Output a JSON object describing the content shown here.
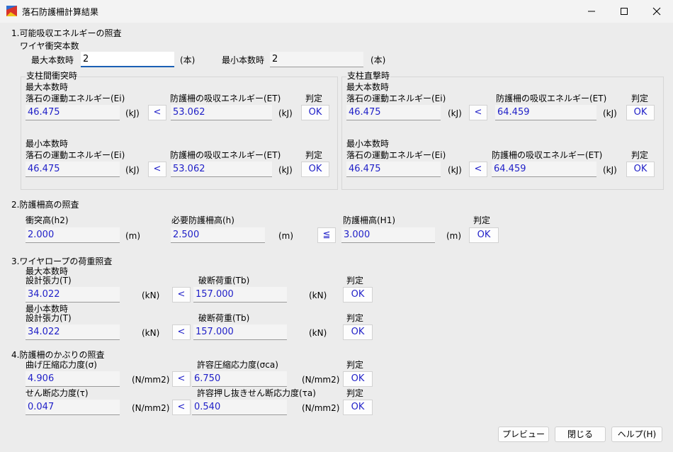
{
  "window": {
    "title": "落石防護柵計算結果"
  },
  "s1": {
    "header": "1.可能吸収エネルギーの照査",
    "wire_count_label": "ワイヤ衝突本数",
    "max_label": "最大本数時",
    "max_value": "2",
    "unit_hon": "(本)",
    "min_label": "最小本数時",
    "min_value": "2",
    "left_group": {
      "title": "支柱間衝突時",
      "max": {
        "label": "最大本数時",
        "ei_label": "落石の運動エネルギー(Ei)",
        "ei": "46.475",
        "unit": "(kJ)",
        "cmp": "<",
        "et_label": "防護柵の吸収エネルギー(ET)",
        "et": "53.062",
        "judge_label": "判定",
        "judge": "OK"
      },
      "min": {
        "label": "最小本数時",
        "ei_label": "落石の運動エネルギー(Ei)",
        "ei": "46.475",
        "unit": "(kJ)",
        "cmp": "<",
        "et_label": "防護柵の吸収エネルギー(ET)",
        "et": "53.062",
        "judge_label": "判定",
        "judge": "OK"
      }
    },
    "right_group": {
      "title": "支柱直撃時",
      "max": {
        "label": "最大本数時",
        "ei_label": "落石の運動エネルギー(Ei)",
        "ei": "46.475",
        "unit": "(kJ)",
        "cmp": "<",
        "et_label": "防護柵の吸収エネルギー(ET)",
        "et": "64.459",
        "judge_label": "判定",
        "judge": "OK"
      },
      "min": {
        "label": "最小本数時",
        "ei_label": "落石の運動エネルギー(Ei)",
        "ei": "46.475",
        "unit": "(kJ)",
        "cmp": "<",
        "et_label": "防護柵の吸収エネルギー(ET)",
        "et": "64.459",
        "judge_label": "判定",
        "judge": "OK"
      }
    }
  },
  "s2": {
    "header": "2.防護柵高の照査",
    "h2_label": "衝突高(h2)",
    "h2": "2.000",
    "unit_m": "(m)",
    "h_label": "必要防護柵高(h)",
    "h": "2.500",
    "cmp": "≦",
    "h1_label": "防護柵高(H1)",
    "h1": "3.000",
    "judge_label": "判定",
    "judge": "OK"
  },
  "s3": {
    "header": "3.ワイヤロープの荷重照査",
    "unit_kn": "(kN)",
    "max": {
      "label": "最大本数時",
      "t_label": "設計張力(T)",
      "t": "34.022",
      "cmp": "<",
      "tb_label": "破断荷重(Tb)",
      "tb": "157.000",
      "judge_label": "判定",
      "judge": "OK"
    },
    "min": {
      "label": "最小本数時",
      "t_label": "設計張力(T)",
      "t": "34.022",
      "cmp": "<",
      "tb_label": "破断荷重(Tb)",
      "tb": "157.000",
      "judge_label": "判定",
      "judge": "OK"
    }
  },
  "s4": {
    "header": "4.防護柵のかぶりの照査",
    "unit": "(N/mm2)",
    "bend": {
      "label": "曲げ圧縮応力度(σ)",
      "value": "4.906",
      "cmp": "<",
      "allow_label": "許容圧縮応力度(σca)",
      "allow": "6.750",
      "judge_label": "判定",
      "judge": "OK"
    },
    "shear": {
      "label": "せん断応力度(τ)",
      "value": "0.047",
      "cmp": "<",
      "allow_label": "許容押し抜きせん断応力度(τa)",
      "allow": "0.540",
      "judge_label": "判定",
      "judge": "OK"
    }
  },
  "buttons": {
    "preview": "プレビュー",
    "close": "閉じる",
    "help": "ヘルプ(H)"
  },
  "colors": {
    "value_text": "#1f1fc8",
    "focus_accent": "#1a5fb4"
  }
}
